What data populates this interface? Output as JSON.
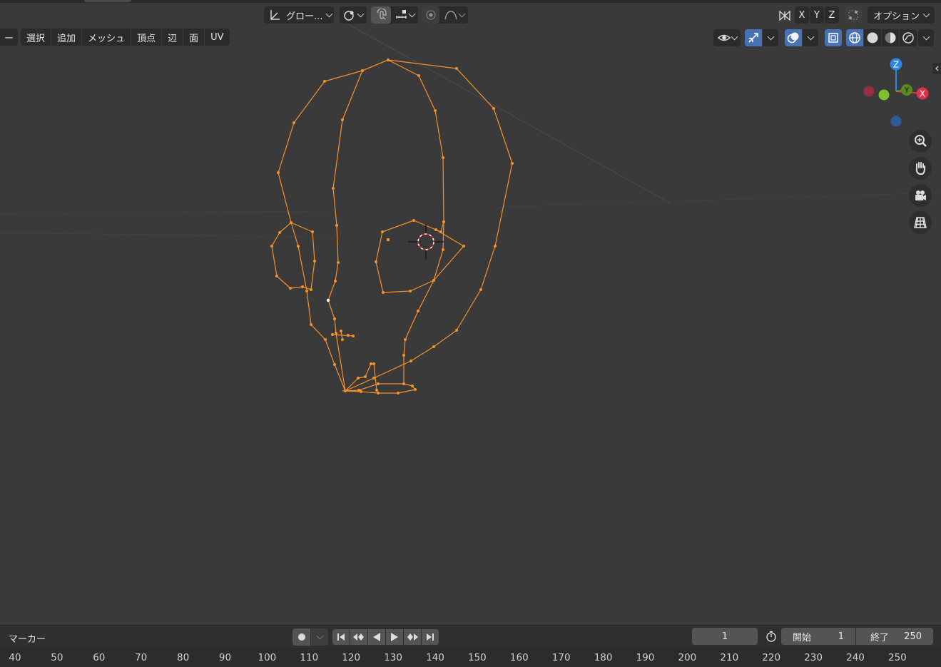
{
  "header": {
    "transform_orientation": "グロー...",
    "options_label": "オプション",
    "axis_x": "X",
    "axis_y": "Y",
    "axis_z": "Z"
  },
  "menu": {
    "items": [
      "ー",
      "選択",
      "追加",
      "メッシュ",
      "頂点",
      "辺",
      "面",
      "UV"
    ]
  },
  "gizmo": {
    "z": "Z",
    "y": "Y",
    "x": "X"
  },
  "timeline": {
    "marker_label": "マーカー",
    "current_frame": "1",
    "start_label": "開始",
    "start_value": "1",
    "end_label": "終了",
    "end_value": "250",
    "ruler_ticks": [
      "40",
      "50",
      "60",
      "70",
      "80",
      "90",
      "100",
      "110",
      "120",
      "130",
      "140",
      "150",
      "160",
      "170",
      "180",
      "190",
      "200",
      "210",
      "220",
      "230",
      "240",
      "250"
    ]
  },
  "colors": {
    "wire": "#f5922b",
    "active": "#4772b3",
    "viewport_bg": "#3a3a3a"
  }
}
